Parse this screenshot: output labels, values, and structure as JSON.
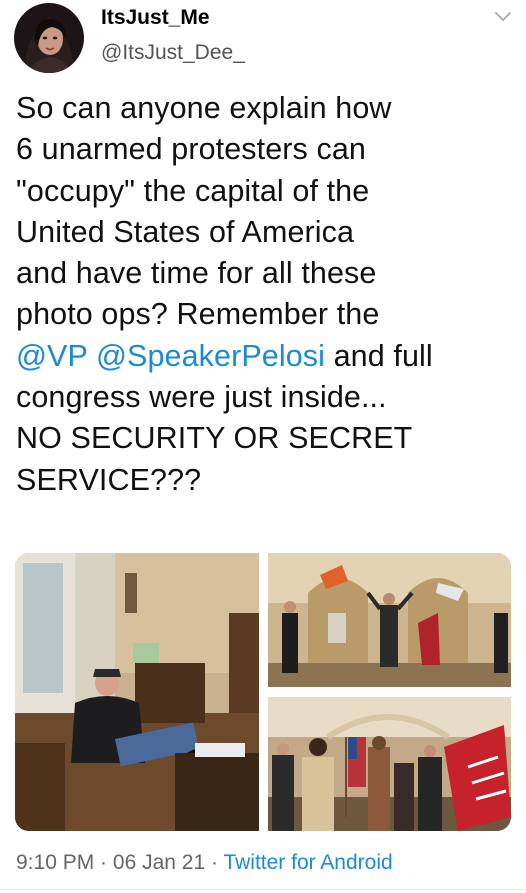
{
  "author": {
    "name": "ItsJust_Me",
    "handle": "@ItsJust_Dee_"
  },
  "tweet": {
    "lines": [
      [
        {
          "text": "So can anyone explain how"
        }
      ],
      [
        {
          "text": "6 unarmed protesters can"
        }
      ],
      [
        {
          "text": "\"occupy\" the capital of the"
        }
      ],
      [
        {
          "text": "United States of America"
        }
      ],
      [
        {
          "text": "and have time for all these"
        }
      ],
      [
        {
          "text": "photo ops? Remember the"
        }
      ],
      [
        {
          "text": "@VP",
          "mention": true
        },
        {
          "text": " "
        },
        {
          "text": "@SpeakerPelosi",
          "mention": true
        },
        {
          "text": " and full"
        }
      ],
      [
        {
          "text": "congress were just inside..."
        }
      ],
      [
        {
          "text": "NO SECURITY OR SECRET"
        }
      ],
      [
        {
          "text": "SERVICE???"
        }
      ]
    ]
  },
  "meta": {
    "time": "9:10 PM",
    "separator": " · ",
    "date": "06 Jan 21",
    "source": "Twitter for Android"
  },
  "icons": {
    "menu": "chevron-down-icon"
  },
  "colors": {
    "link": "#1b8bd6",
    "text": "#111111",
    "secondary": "#666666"
  }
}
